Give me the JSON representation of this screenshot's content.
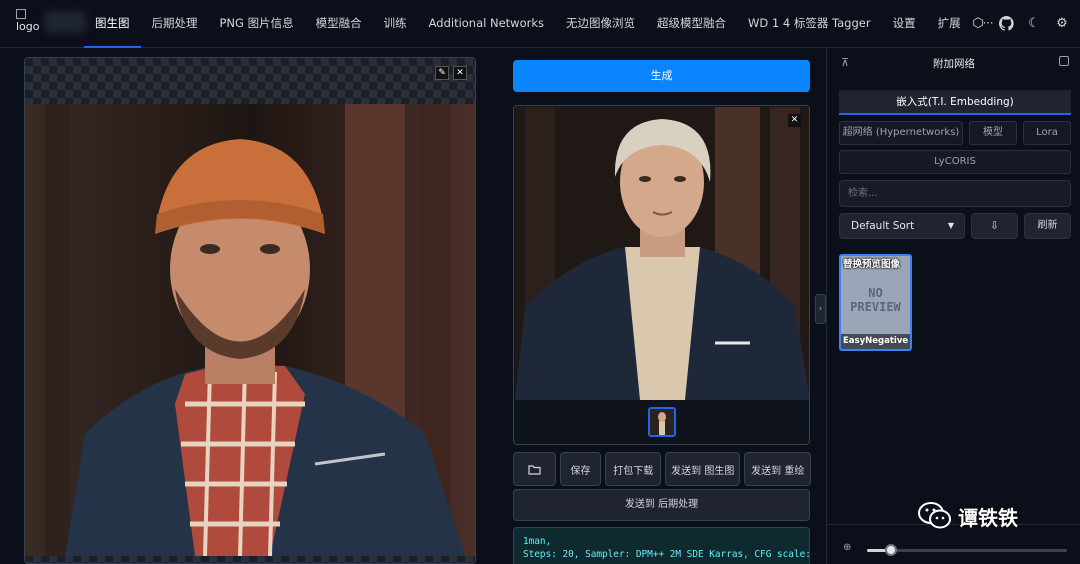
{
  "logo": {
    "alt": "logo"
  },
  "nav": {
    "tabs": [
      {
        "label": "图生图"
      },
      {
        "label": "后期处理"
      },
      {
        "label": "PNG 图片信息"
      },
      {
        "label": "模型融合"
      },
      {
        "label": "训练"
      },
      {
        "label": "Additional Networks"
      },
      {
        "label": "无边图像浏览"
      },
      {
        "label": "超级模型融合"
      },
      {
        "label": "WD 1 4 标签器 Tagger"
      },
      {
        "label": "设置"
      },
      {
        "label": "扩展"
      },
      {
        "label": "···"
      }
    ],
    "active_index": 0
  },
  "main": {
    "generate_label": "生成",
    "actions": {
      "folder_icon": "folder-icon",
      "save": "保存",
      "zip": "打包下载",
      "to_img2img": "发送到 图生图",
      "to_inpaint": "发送到 重绘",
      "to_extras": "发送到 后期处理"
    },
    "info_lines": [
      "1man,",
      "Steps: 20, Sampler: DPM++ 2M SDE Karras, CFG scale:"
    ]
  },
  "networks": {
    "title": "附加网络",
    "tabs": {
      "embedding": "嵌入式(T.I. Embedding)",
      "hypernetworks": "超网络 (Hypernetworks)",
      "checkpoints": "模型",
      "lora": "Lora",
      "lycoris": "LyCORIS"
    },
    "search_placeholder": "检索...",
    "sort_value": "Default Sort",
    "refresh_label": "刷新",
    "cards": [
      {
        "overlay": "替换预览图像",
        "preview": "NO PREVIEW",
        "name": "EasyNegative"
      }
    ],
    "zoom_level": 0.12
  },
  "watermark": {
    "text": "谭铁铁"
  },
  "colors": {
    "accent": "#0a84ff",
    "tab_underline": "#2563eb",
    "info_text": "#67e8f9"
  }
}
